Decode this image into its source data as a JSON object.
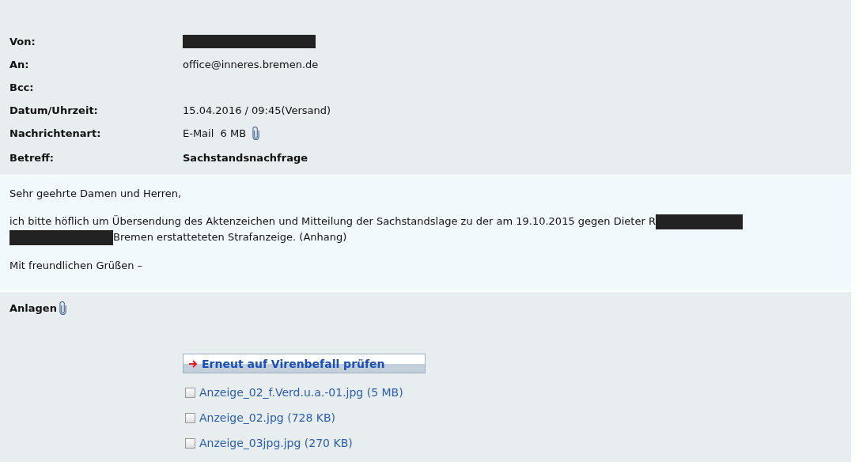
{
  "header_fields": [
    {
      "label": "Von:",
      "redacted": true
    },
    {
      "label": "An:",
      "value": "office@inneres.bremen.de"
    },
    {
      "label": "Bcc:"
    },
    {
      "label": "Datum/Uhrzeit:",
      "value": "15.04.2016 / 09:45(Versand)"
    },
    {
      "label": "Nachrichtenart:",
      "value": "E-Mail  6 MB",
      "attachment": true
    },
    {
      "label": "Betreff:",
      "value": "Sachstandsnachfrage",
      "kind": "subject"
    }
  ],
  "body": [
    [
      {
        "kind": "text",
        "text": "Sehr geehrte Damen und Herren,"
      }
    ],
    [
      {
        "kind": "text",
        "text": "ich bitte höflich um Übersendung des Aktenzeichen und Mitteilung der Sachstandslage zu der am 19.10.2015 gegen Dieter R"
      },
      {
        "kind": "redacted"
      },
      {
        "kind": "redacted"
      },
      {
        "kind": "text",
        "text": "Bremen erstatteteten Strafanzeige. (Anhang)"
      }
    ],
    [
      {
        "kind": "text",
        "text": "Mit freundlichen Grüßen –"
      }
    ]
  ],
  "attachments": {
    "title": "Anlagen",
    "scan_button": "Erneut auf Virenbefall prüfen",
    "files": [
      {
        "name": "Anzeige_02_f.Verd.u.a.-01.jpg (5 MB)",
        "checked": false
      },
      {
        "name": "Anzeige_02.jpg (728 KB)",
        "checked": false
      },
      {
        "name": "Anzeige_03jpg.jpg (270 KB)",
        "checked": false
      }
    ]
  }
}
